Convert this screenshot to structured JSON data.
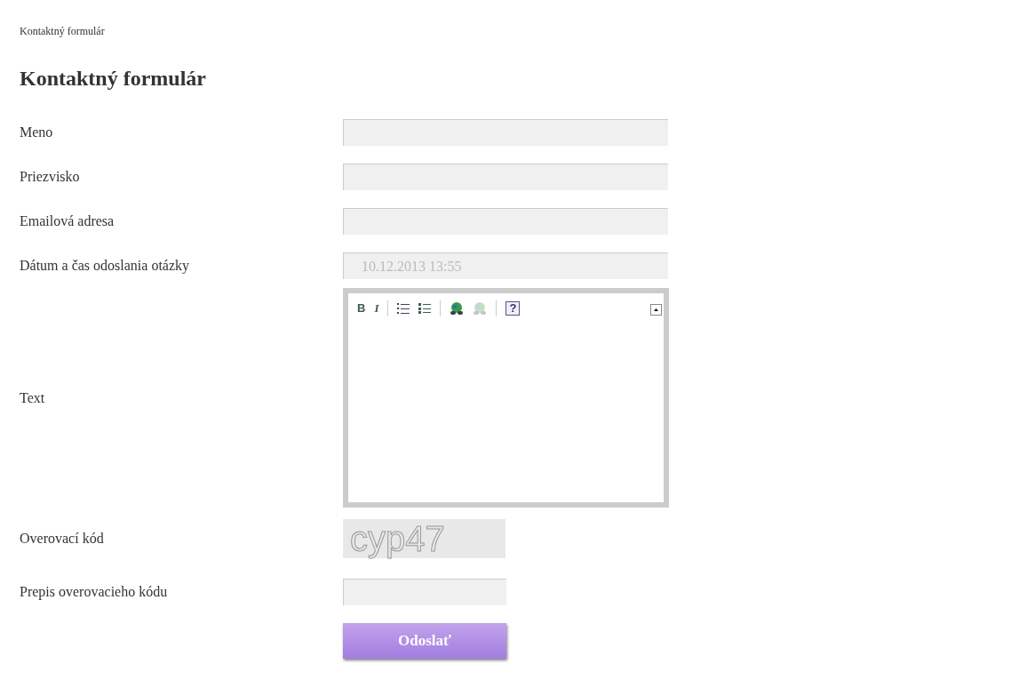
{
  "breadcrumb": "Kontaktný formulár",
  "title": "Kontaktný formulár",
  "fields": [
    {
      "kind": "input",
      "label": "Meno"
    },
    {
      "kind": "input",
      "label": "Priezvisko"
    },
    {
      "kind": "input",
      "label": "Emailová adresa"
    },
    {
      "kind": "readonly",
      "label": "Dátum a čas odoslania otázky",
      "value": "10.12.2013 13:55"
    },
    {
      "kind": "editor",
      "label": "Text",
      "tools": [
        {
          "kind": "bold",
          "label": "B",
          "disabled": false
        },
        {
          "kind": "italic",
          "label": "I",
          "disabled": false
        },
        {
          "kind": "separator"
        },
        {
          "kind": "ordered-list",
          "disabled": false
        },
        {
          "kind": "bullet-list",
          "disabled": false
        },
        {
          "kind": "separator"
        },
        {
          "kind": "link",
          "disabled": false
        },
        {
          "kind": "unlink",
          "disabled": true
        },
        {
          "kind": "separator"
        },
        {
          "kind": "help",
          "label": "?",
          "disabled": false
        }
      ]
    },
    {
      "kind": "captcha",
      "label": "Overovací kód",
      "value": "cyp47"
    },
    {
      "kind": "captcha-input",
      "label": "Prepis overovacieho kódu"
    }
  ],
  "submit": "Odoslať"
}
